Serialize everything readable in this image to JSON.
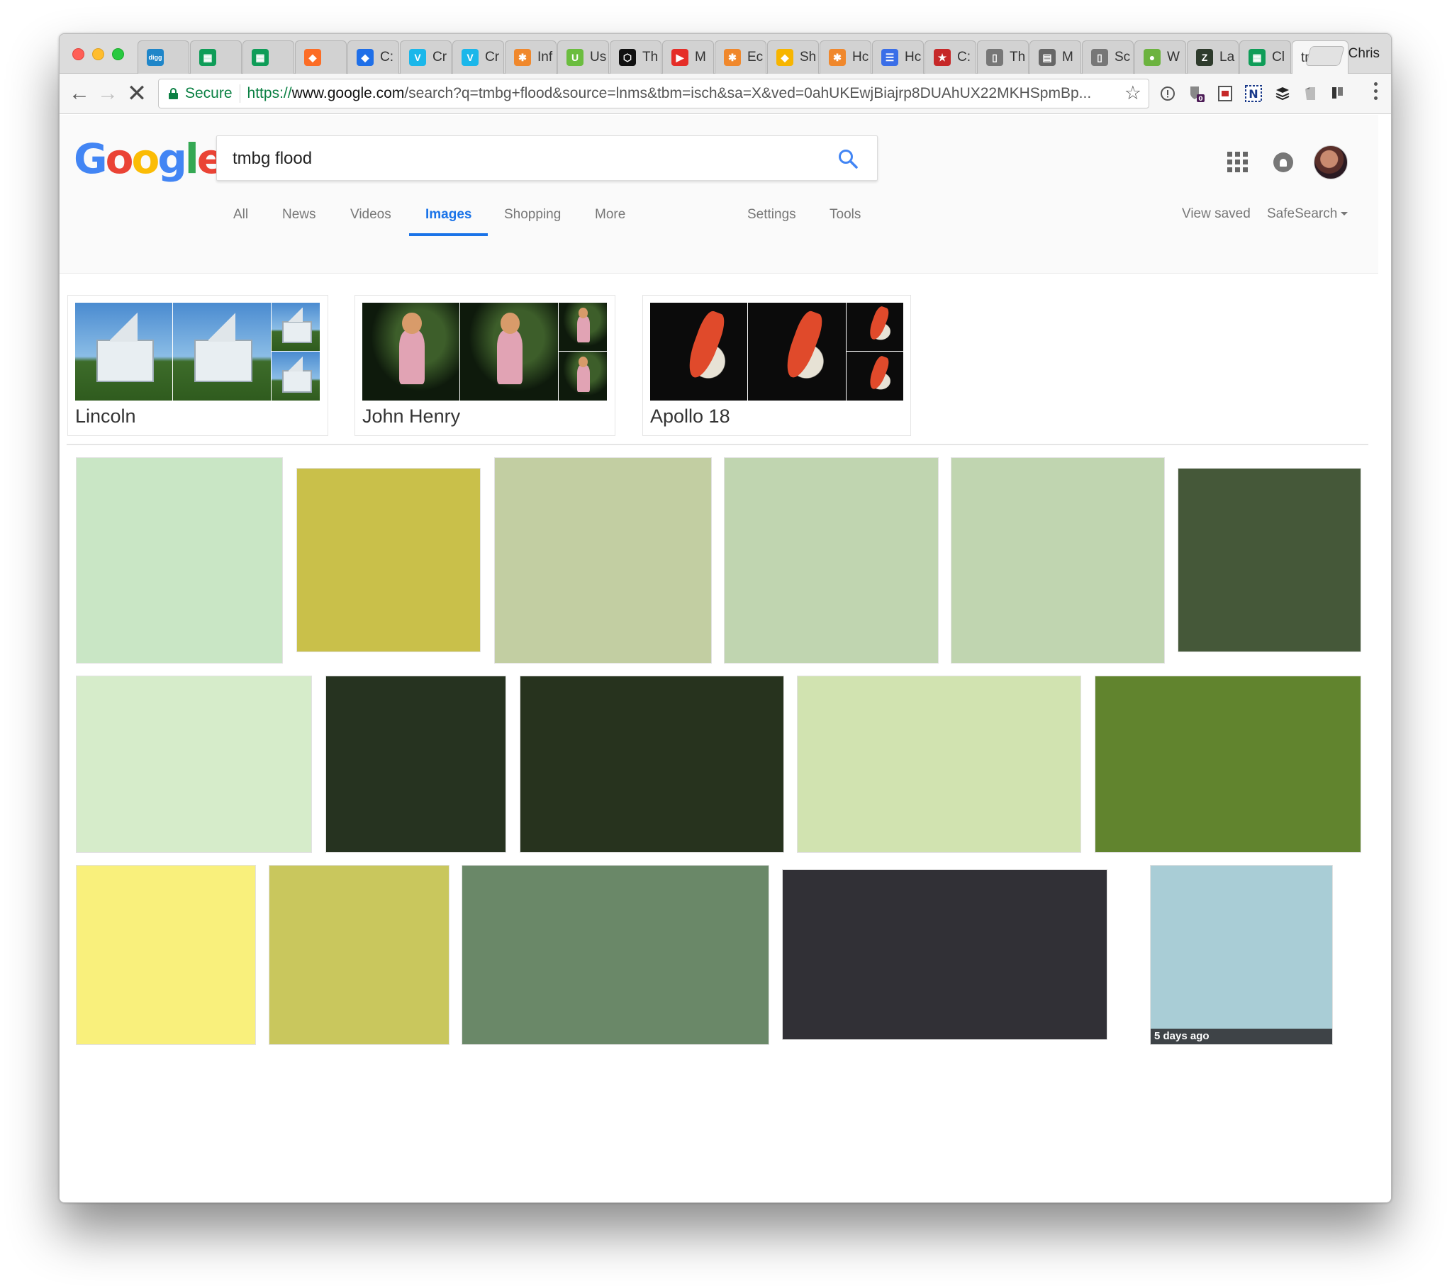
{
  "browser": {
    "profile_name": "Chris",
    "tabs": [
      {
        "icon": "digg-icon",
        "title": "",
        "color": "#1f86c9",
        "glyph": "digg"
      },
      {
        "icon": "sheets-icon",
        "title": "",
        "color": "#0f9d58",
        "glyph": "▦"
      },
      {
        "icon": "sheets-icon",
        "title": "",
        "color": "#0f9d58",
        "glyph": "▦"
      },
      {
        "icon": "gitlab-icon",
        "title": "",
        "color": "#fc6d26",
        "glyph": "◆"
      },
      {
        "icon": "dropbox-icon",
        "title": "C:",
        "color": "#1f6fe8",
        "glyph": "◆"
      },
      {
        "icon": "vimeo-icon",
        "title": "Cr",
        "color": "#1ab7ea",
        "glyph": "V"
      },
      {
        "icon": "vimeo-icon",
        "title": "Cr",
        "color": "#1ab7ea",
        "glyph": "V"
      },
      {
        "icon": "asterisk-icon",
        "title": "Inf",
        "color": "#f0882c",
        "glyph": "✱"
      },
      {
        "icon": "upwork-icon",
        "title": "Us",
        "color": "#6bbd3f",
        "glyph": "U"
      },
      {
        "icon": "codepen-icon",
        "title": "Th",
        "color": "#111111",
        "glyph": "⬡"
      },
      {
        "icon": "youtube-icon",
        "title": "M",
        "color": "#e52d27",
        "glyph": "▶"
      },
      {
        "icon": "asterisk-icon",
        "title": "Ec",
        "color": "#f0882c",
        "glyph": "✱"
      },
      {
        "icon": "sketch-icon",
        "title": "Sh",
        "color": "#f7b500",
        "glyph": "◆"
      },
      {
        "icon": "asterisk-icon",
        "title": "Hc",
        "color": "#f0882c",
        "glyph": "✱"
      },
      {
        "icon": "list-icon",
        "title": "Hc",
        "color": "#3a6ee8",
        "glyph": "☰"
      },
      {
        "icon": "star-icon",
        "title": "C:",
        "color": "#c62828",
        "glyph": "★"
      },
      {
        "icon": "document-icon",
        "title": "Th",
        "color": "#777777",
        "glyph": "▯"
      },
      {
        "icon": "newspaper-icon",
        "title": "M",
        "color": "#666666",
        "glyph": "▤"
      },
      {
        "icon": "document-icon",
        "title": "Sc",
        "color": "#777777",
        "glyph": "▯"
      },
      {
        "icon": "leaf-icon",
        "title": "W",
        "color": "#6cb33f",
        "glyph": "●"
      },
      {
        "icon": "zotero-icon",
        "title": "La",
        "color": "#2e3b2c",
        "glyph": "Z"
      },
      {
        "icon": "sheets-icon",
        "title": "Cl",
        "color": "#0f9d58",
        "glyph": "▦"
      }
    ],
    "active_tab": {
      "title": "tmb",
      "close": "×"
    },
    "nav": {
      "back": "←",
      "forward": "→",
      "stop": "✕"
    },
    "address": {
      "secure_label": "Secure",
      "protocol": "https://",
      "host": "www.google.com",
      "path": "/search?q=tmbg+flood&source=lnms&tbm=isch&sa=X&ved=0ahUKEwjBiajrp8DUAhUX22MKHSpmBp..."
    },
    "extensions": [
      "info-icon",
      "ublock-icon",
      "pdf-icon",
      "noscript-icon",
      "buffer-icon",
      "evernote-icon",
      "readability-icon"
    ]
  },
  "google": {
    "logo": [
      "G",
      "o",
      "o",
      "g",
      "l",
      "e"
    ],
    "search": {
      "query": "tmbg flood",
      "placeholder": ""
    },
    "tabs": {
      "all": "All",
      "news": "News",
      "videos": "Videos",
      "images": "Images",
      "shopping": "Shopping",
      "more": "More",
      "settings": "Settings",
      "tools": "Tools",
      "view_saved": "View saved",
      "safesearch": "SafeSearch"
    },
    "related": [
      {
        "label": "Lincoln"
      },
      {
        "label": "John Henry"
      },
      {
        "label": "Apollo 18"
      }
    ],
    "result_colors": [
      "#c9e6c5",
      "#c9c04a",
      "#c2cea2",
      "#c0d5b0",
      "#c0d5b0",
      "#455839",
      "#d6ecca",
      "#263320",
      "#27331e",
      "#d1e3b0",
      "#61842e",
      "#f9f07c",
      "#c9c75d",
      "#6a8868",
      "#313036",
      "#a9cdd6"
    ],
    "badge": "5 days ago"
  }
}
